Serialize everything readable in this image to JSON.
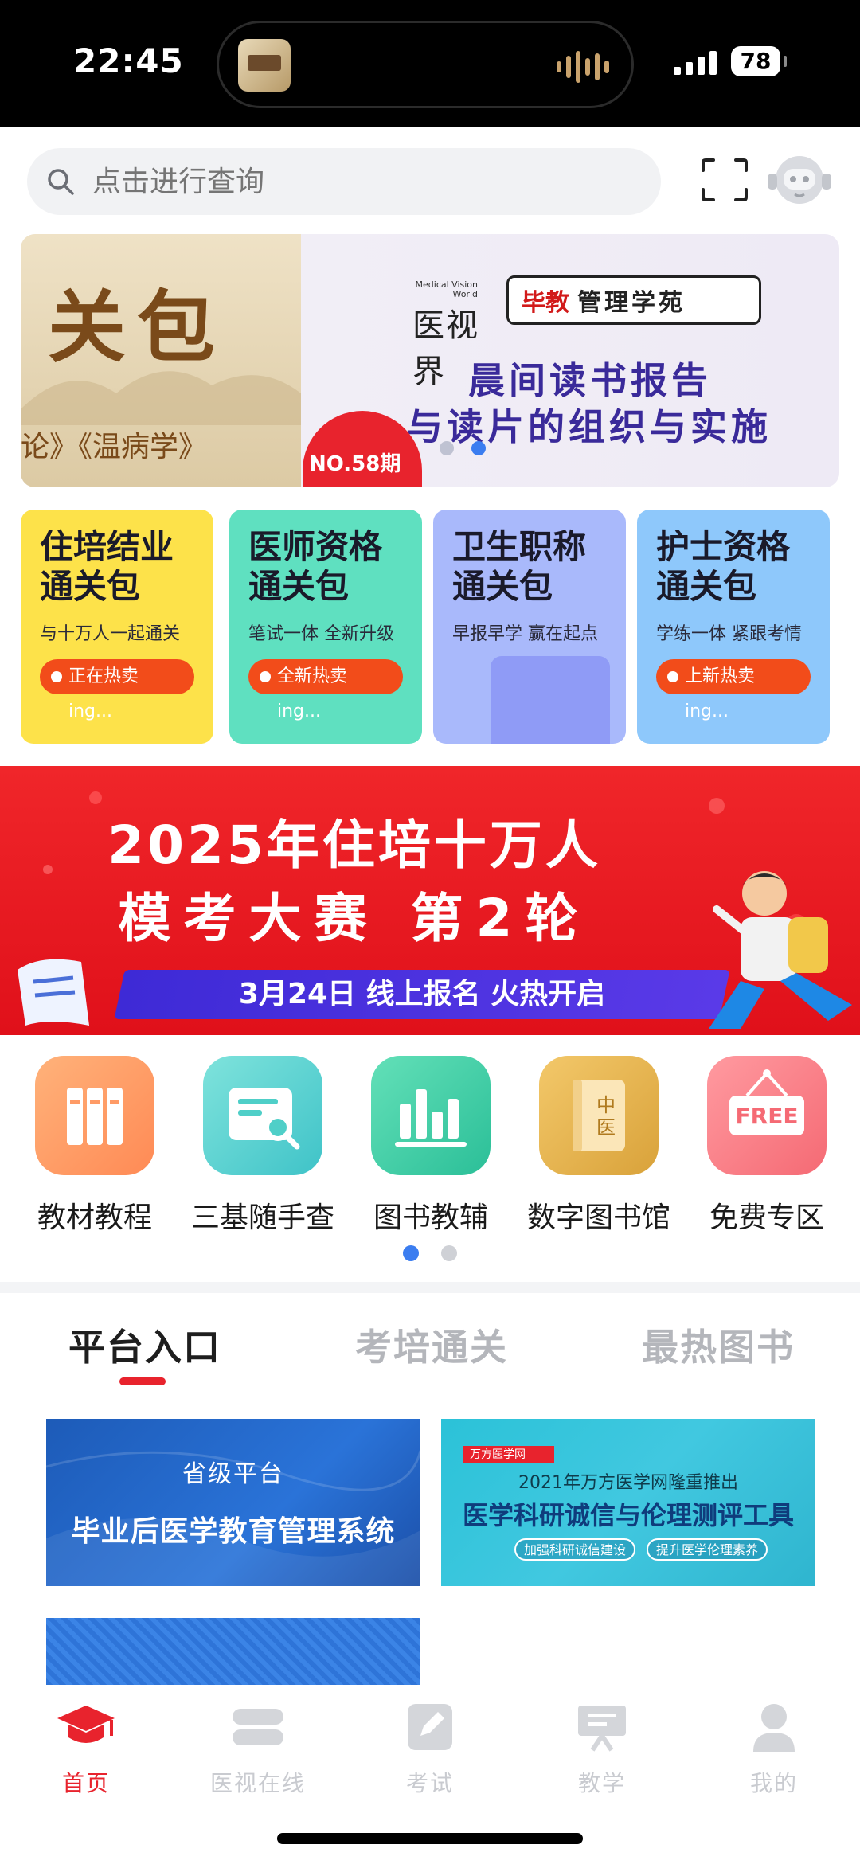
{
  "status_bar": {
    "time": "22:45",
    "battery": "78"
  },
  "search": {
    "placeholder": "点击进行查询"
  },
  "banner": {
    "left_big": "关包",
    "left_sub": "论》《温病学》",
    "brand_small": "Medical Vision World",
    "brand_name": "医视界",
    "partner_red": "毕教",
    "partner_black": "管理学苑",
    "title_line1": "晨间读书报告",
    "title_line2": "与读片的组织与实施",
    "issue": "NO.58期",
    "dots": 2,
    "active_dot": 1
  },
  "cards": [
    {
      "title": "住培结业通关包",
      "subtitle": "与十万人一起通关",
      "pill": "正在热卖ing...",
      "bg": "#fde24a"
    },
    {
      "title": "医师资格通关包",
      "subtitle": "笔试一体 全新升级",
      "pill": "全新热卖ing...",
      "bg": "#5fe0c0"
    },
    {
      "title": "卫生职称通关包",
      "subtitle": "早报早学 赢在起点",
      "pill": "",
      "bg": "#a9b9fb"
    },
    {
      "title": "护士资格通关包",
      "subtitle": "学练一体 紧跟考情",
      "pill": "上新热卖ing...",
      "bg": "#8ec8fb"
    }
  ],
  "promo": {
    "line1": "2025年住培十万人",
    "line2": "模考大赛 第2轮",
    "ribbon": "3月24日 线上报名 火热开启"
  },
  "functions": [
    {
      "label": "教材教程",
      "icon": "books-icon",
      "color_a": "#ffb27a",
      "color_b": "#ff8a55"
    },
    {
      "label": "三基随手查",
      "icon": "search-doc-icon",
      "color_a": "#7fe3dc",
      "color_b": "#3fc3c8"
    },
    {
      "label": "图书教辅",
      "icon": "bar-chart-icon",
      "color_a": "#63e0b8",
      "color_b": "#2bbf98"
    },
    {
      "label": "数字图书馆",
      "icon": "tcm-book-icon",
      "color_a": "#f3c86a",
      "color_b": "#d9a23a"
    },
    {
      "label": "免费专区",
      "icon": "free-sign-icon",
      "color_a": "#ff9aa0",
      "color_b": "#f56a74"
    }
  ],
  "function_pages": {
    "total": 2,
    "active": 0
  },
  "tabs": [
    {
      "label": "平台入口",
      "active": true
    },
    {
      "label": "考培通关",
      "active": false
    },
    {
      "label": "最热图书",
      "active": false
    }
  ],
  "platform": {
    "tile1_small": "省级平台",
    "tile1_big": "毕业后医学教育管理系统",
    "tile2_logo": "万方医学网",
    "tile2_line1": "2021年万方医学网隆重推出",
    "tile2_line2": "医学科研诚信与伦理测评工具",
    "tile2_tags": [
      "加强科研诚信建设",
      "提升医学伦理素养"
    ]
  },
  "bottom_nav": [
    {
      "label": "首页",
      "icon": "graduation-cap-icon",
      "active": true
    },
    {
      "label": "医视在线",
      "icon": "video-stack-icon",
      "active": false
    },
    {
      "label": "考试",
      "icon": "exam-edit-icon",
      "active": false
    },
    {
      "label": "教学",
      "icon": "teaching-board-icon",
      "active": false
    },
    {
      "label": "我的",
      "icon": "person-icon",
      "active": false
    }
  ],
  "colors": {
    "accent": "#e8232d",
    "dot_active": "#3b7df0",
    "promo_red": "#f0262a"
  }
}
